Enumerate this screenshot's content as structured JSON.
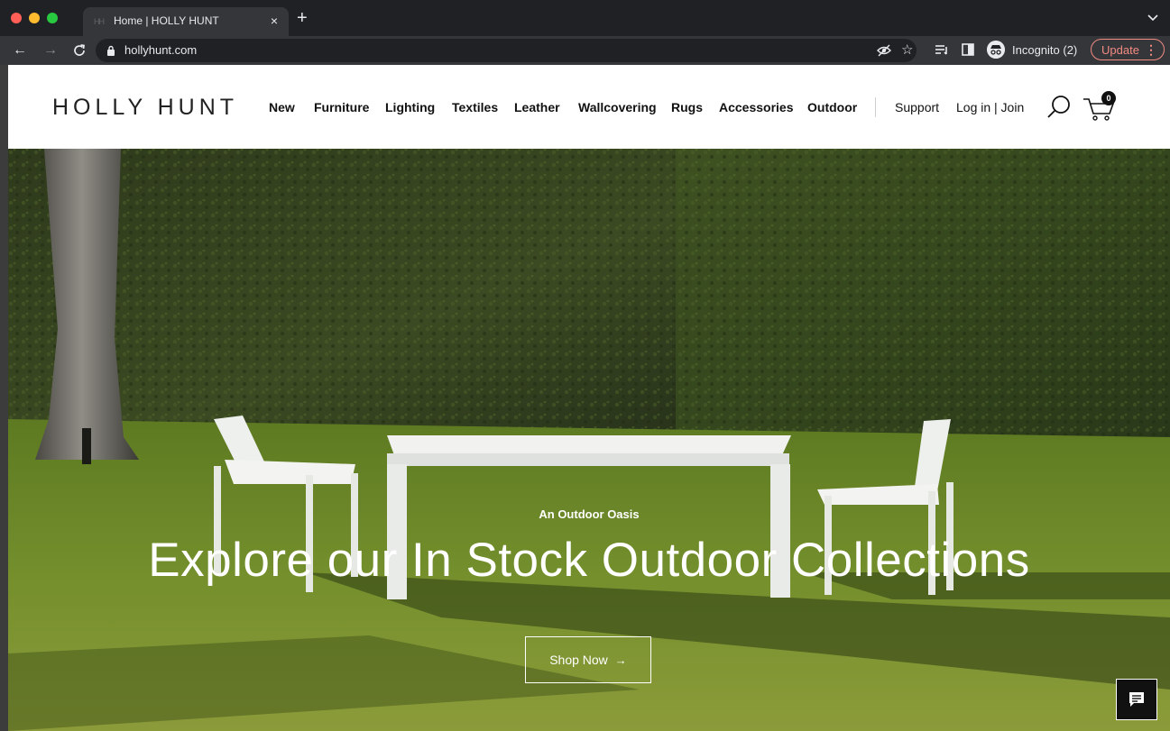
{
  "browser": {
    "tab": {
      "favicon": "HH",
      "title": "Home | HOLLY HUNT",
      "close_icon": "×"
    },
    "new_tab_icon": "+",
    "nav": {
      "back": "←",
      "forward": "→",
      "reload": "C"
    },
    "url": "hollyhunt.com",
    "icons": {
      "eye": "⊘",
      "star": "☆",
      "reading_list": "≡",
      "side_panel": "▢"
    },
    "incognito_label": "Incognito (2)",
    "update_label": "Update",
    "update_menu": "⋮"
  },
  "site": {
    "logo": "HOLLY HUNT",
    "nav": [
      "New",
      "Furniture",
      "Lighting",
      "Textiles",
      "Leather",
      "Wallcovering",
      "Rugs",
      "Accessories",
      "Outdoor"
    ],
    "support": "Support",
    "login": "Log in | Join",
    "cart_count": "0"
  },
  "hero": {
    "eyebrow": "An Outdoor Oasis",
    "title": "Explore our In Stock Outdoor Collections",
    "cta": "Shop Now",
    "cta_arrow": "→"
  },
  "colors": {
    "chrome_dark": "#202124",
    "chrome_bar": "#35363a",
    "update_accent": "#f28b82",
    "hedge": "#2f3b1b",
    "lawn": "#6f8a2a"
  }
}
